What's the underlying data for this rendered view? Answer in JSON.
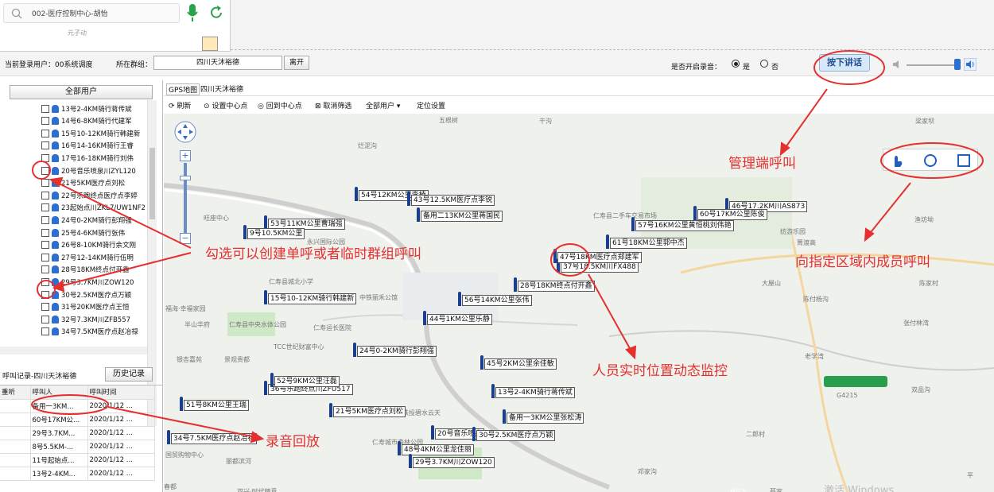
{
  "top": {
    "search_text": "002-医疗控制中心-胡怡",
    "map_hint": "元子动"
  },
  "status_bar": {
    "login_label": "当前登录用户：00系统调度",
    "group_label": "所在群组：",
    "group_value": "四川天沐裕德",
    "leave_button": "离开",
    "record_label": "是否开启录音：",
    "yes_label": "是",
    "no_label": "否",
    "ptt_button": "按下讲话"
  },
  "left_panel": {
    "all_users_label": "全部用户",
    "users": [
      "13号2-4KM骑行蒋传斌",
      "14号6-8KM骑行代建军",
      "15号10-12KM骑行韩建新",
      "16号14-16KM骑行王睿",
      "17号16-18KM骑行刘伟",
      "20号音乐喷泉川ZYL120",
      "21号5KM医疗点刘松",
      "22号乐跑终点医疗点李婷",
      "23起始点川ZKL7/UW1NF2",
      "24号0-2KM骑行彭翔强",
      "25号4-6KM骑行张伟",
      "26号8-10KM骑行余文刚",
      "27号12-14KM骑行伍明",
      "28号18KM终点付开鑫",
      "29号3.7KM川ZOW120",
      "30号2.5KM医疗点万颖",
      "31号20KM医疗点王恒",
      "32号7.3KM川ZFB557",
      "34号7.5KM医疗点赵冶禄"
    ],
    "call_log_title": "呼叫记录-四川天沐裕德",
    "history_button": "历史记录",
    "col_listen": "重听",
    "col_caller": "呼叫人",
    "col_time": "呼叫时间",
    "calls": [
      {
        "caller": "备用一3KM...",
        "time": "2020/1/12 ..."
      },
      {
        "caller": "60号17KM公...",
        "time": "2020/1/12 ..."
      },
      {
        "caller": "29号3.7KM...",
        "time": "2020/1/12 ..."
      },
      {
        "caller": "8号5.5KM-...",
        "time": "2020/1/12 ..."
      },
      {
        "caller": "11号起始点...",
        "time": "2020/1/12 ..."
      },
      {
        "caller": "13号2-4KM...",
        "time": "2020/1/12 ..."
      }
    ]
  },
  "map": {
    "tabs": [
      "GPS地图",
      "四川天沐裕德"
    ],
    "toolbar": {
      "refresh": "刷新",
      "set_center": "设置中心点",
      "back_center": "回到中心点",
      "cancel_filter": "取消筛选",
      "all_users": "全部用户",
      "locate_settings": "定位设置"
    },
    "markers": [
      "54号12KM公里李楠",
      "43号12.5KM医疗点李锐",
      "备用二13KM公里蒋国民",
      "53号11KM公里曹瑞强",
      "9号10.5KM公里",
      "46号17.2KM川AS873",
      "60号17KM公里陈俊",
      "57号16KM公里黄恒桃刘伟艳",
      "61号18KM公里郭中杰",
      "37号18.5KM川FX488",
      "47号18KM医疗点郑建军",
      "28号18KM终点付开鑫",
      "56号14KM公里张伟",
      "44号1KM公里乐静",
      "15号10-12KM骑行韩建新",
      "24号0-2KM骑行彭翔强",
      "45号2KM公里余佳敏",
      "13号2-4KM骑行蒋传斌",
      "36号乐跑终点川ZFU517",
      "52号9KM公里汪磊",
      "51号8KM公里王瑞",
      "21号5KM医疗点刘松",
      "备用一3KM公里张松涛",
      "20号音乐喷泉",
      "30号2.5KM医疗点万颖",
      "48号4KM公里龙佳丽",
      "29号3.7KM川ZOW120",
      "34号7.5KM医疗点赵冶禄"
    ],
    "places": [
      "五根树",
      "干沟",
      "梁家坝",
      "烂泥沟",
      "旺座中心",
      "仁寿县二手车交易市场",
      "大屋山",
      "陈家村",
      "陈付杨沟",
      "张付林湾",
      "老学湾",
      "双品沟",
      "二郎村",
      "邓家沟",
      "仁寿县城北小学",
      "中铁丽禾公馆",
      "仁寿县中央水体公园",
      "仁寿运长医院",
      "TCC世纪财富中心",
      "银杏嘉苑",
      "景观贵都",
      "铁投碧水云天",
      "仁寿城市森林公园",
      "国贸购物中心",
      "丽都滨河",
      "双兴·时代精意",
      "春都",
      "半山华府",
      "福海·幸福家园",
      "蔡家",
      "渔坊坳",
      "箐渡高",
      "G4215",
      "林家沟",
      "平",
      "纺游乐园",
      "永兴国际公园",
      "激活 Windows"
    ],
    "annotations": {
      "manager_call": "管理端呼叫",
      "area_call": "向指定区域内成员呼叫",
      "check_call": "勾选可以创建单呼或者临时群组呼叫",
      "realtime": "人员实时位置动态监控",
      "playback": "录音回放"
    }
  },
  "colors": {
    "annotation_red": "#e53030",
    "marker_blue": "#1b3e8f",
    "ptt_bg": "#d9e8f7"
  }
}
